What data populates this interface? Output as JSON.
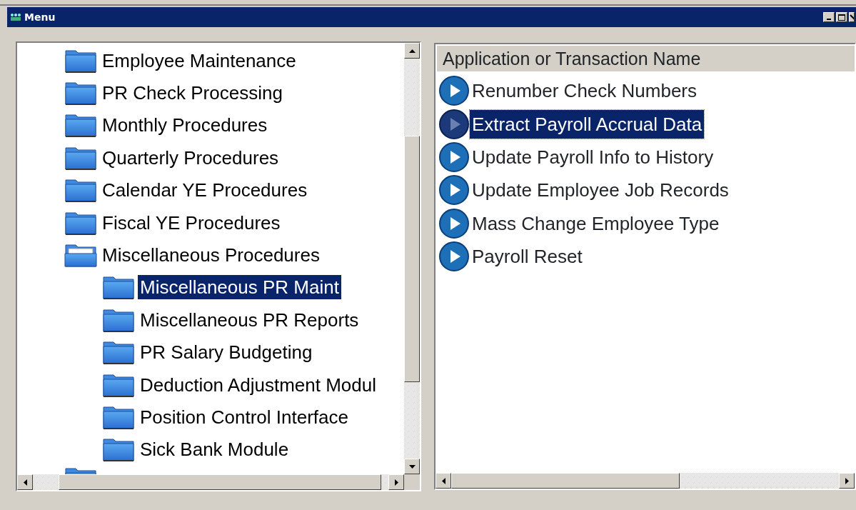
{
  "window": {
    "title": "Menu"
  },
  "tree": {
    "items": [
      {
        "label": "Employee Maintenance",
        "expanded": false,
        "selected": false
      },
      {
        "label": "PR Check Processing",
        "expanded": false,
        "selected": false
      },
      {
        "label": "Monthly Procedures",
        "expanded": false,
        "selected": false
      },
      {
        "label": "Quarterly Procedures",
        "expanded": false,
        "selected": false
      },
      {
        "label": "Calendar YE Procedures",
        "expanded": false,
        "selected": false
      },
      {
        "label": "Fiscal YE Procedures",
        "expanded": false,
        "selected": false
      },
      {
        "label": "Miscellaneous Procedures",
        "expanded": true,
        "selected": false,
        "children": [
          {
            "label": "Miscellaneous PR Maint",
            "expanded": false,
            "selected": true
          },
          {
            "label": "Miscellaneous PR Reports",
            "expanded": false,
            "selected": false
          },
          {
            "label": "PR Salary Budgeting",
            "expanded": false,
            "selected": false
          },
          {
            "label": "Deduction Adjustment Modul",
            "expanded": false,
            "selected": false
          },
          {
            "label": "Position Control Interface",
            "expanded": false,
            "selected": false
          },
          {
            "label": "Sick Bank Module",
            "expanded": false,
            "selected": false
          }
        ]
      },
      {
        "kind": "clipped",
        "expanded": false
      }
    ]
  },
  "list": {
    "header": "Application or Transaction Name",
    "rows": [
      {
        "label": "Renumber Check Numbers",
        "selected": false
      },
      {
        "label": "Extract Payroll Accrual Data",
        "selected": true
      },
      {
        "label": "Update Payroll Info to History",
        "selected": false
      },
      {
        "label": "Update Employee Job Records",
        "selected": false
      },
      {
        "label": "Mass Change Employee Type",
        "selected": false
      },
      {
        "label": "Payroll Reset",
        "selected": false
      }
    ]
  }
}
